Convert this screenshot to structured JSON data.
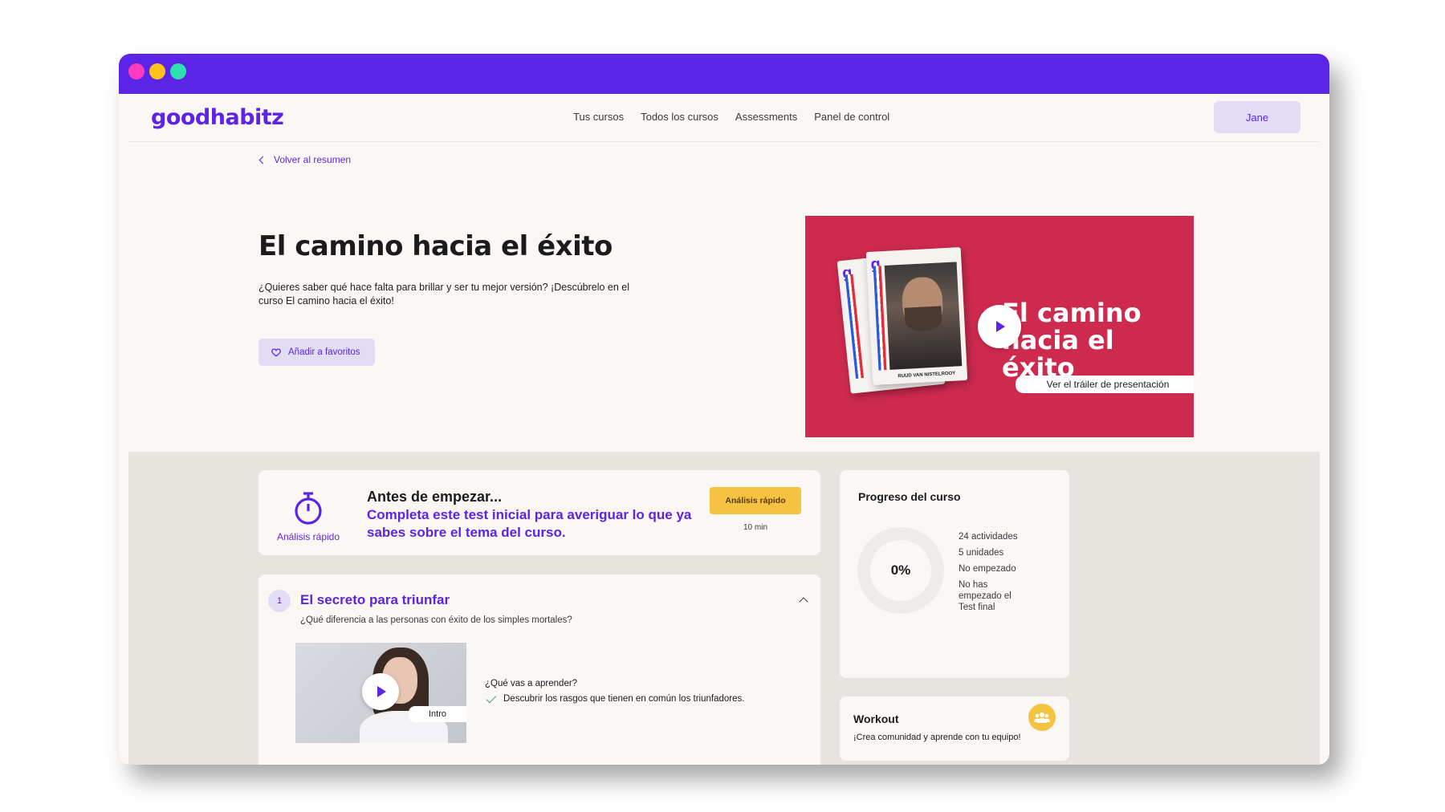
{
  "app": {
    "logo": "goodhabitz"
  },
  "nav": {
    "links": [
      "Tus cursos",
      "Todos los cursos",
      "Assessments",
      "Panel de control"
    ],
    "user": "Jane"
  },
  "back_link": "Volver al resumen",
  "hero": {
    "title": "El camino hacia el éxito",
    "description": "¿Quieres saber qué hace falta para brillar y ser tu mejor versión? ¡Descúbrelo en el curso El camino hacia el éxito!",
    "favorite_label": "Añadir a favoritos"
  },
  "trailer": {
    "title_line1": "El camino",
    "title_line2": "hacia el éxito",
    "caption": "Ver el tráiler de presentación",
    "card_name": "RUUD VAN NISTELROOY"
  },
  "before_start": {
    "icon_label": "Análisis rápido",
    "title": "Antes de empezar...",
    "subtitle": "Completa este test inicial para averiguar lo que ya sabes sobre el tema del curso.",
    "button": "Análisis rápido",
    "duration": "10 min"
  },
  "progress": {
    "title": "Progreso del curso",
    "percent": "0%",
    "activities": "24 actividades",
    "units": "5 unidades",
    "status": "No empezado",
    "final_test": "No has empezado el Test final"
  },
  "workout": {
    "title": "Workout",
    "subtitle": "¡Crea comunidad y aprende con tu equipo!"
  },
  "unit": {
    "number": "1",
    "title": "El secreto para triunfar",
    "description": "¿Qué diferencia a las personas con éxito de los simples mortales?",
    "thumb_label": "Intro",
    "learn_question": "¿Qué vas a aprender?",
    "learn_items": [
      "Descubrir los rasgos que tienen en común los triunfadores."
    ]
  },
  "colors": {
    "brand": "#5b24e6",
    "trailer_bg": "#cd2a4e",
    "accent_yellow": "#f5c242",
    "soft_purple": "#e2dcf5"
  }
}
